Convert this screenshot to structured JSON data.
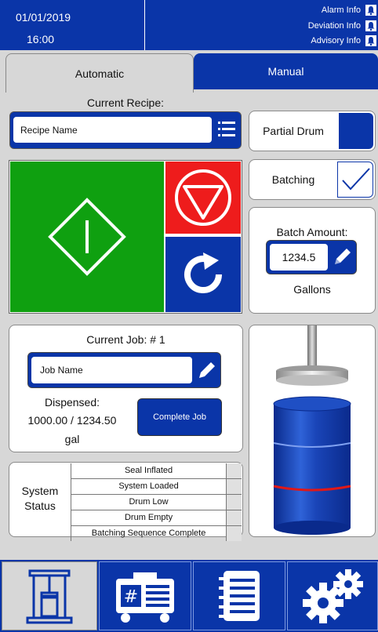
{
  "header": {
    "date": "01/01/2019",
    "time": "16:00",
    "alarm_info": "Alarm Info",
    "deviation_info": "Deviation Info",
    "advisory_info": "Advisory Info"
  },
  "tabs": {
    "automatic": "Automatic",
    "manual": "Manual"
  },
  "recipe": {
    "label": "Current Recipe:",
    "value": "Recipe Name"
  },
  "partial_drum": {
    "label": "Partial Drum"
  },
  "batching": {
    "label": "Batching",
    "checked": true
  },
  "batch_amount": {
    "label": "Batch Amount:",
    "value": "1234.5",
    "unit": "Gallons"
  },
  "current_job": {
    "label": "Current Job: # 1",
    "job_name": "Job Name",
    "dispensed_label": "Dispensed:",
    "dispensed_value": "1000.00 / 1234.50",
    "dispensed_unit": "gal",
    "complete_button": "Complete Job"
  },
  "system_status": {
    "label_line1": "System",
    "label_line2": "Status",
    "items": [
      "Seal Inflated",
      "System Loaded",
      "Drum Low",
      "Drum Empty",
      "Batching Sequence Complete"
    ]
  },
  "colors": {
    "brand_blue": "#0a35a8",
    "start_green": "#0fa010",
    "stop_red": "#ee1c1c",
    "panel_gray": "#d7d7d7",
    "drum_band_red": "#e01818"
  },
  "nav": {
    "items": [
      "press-machine-icon",
      "drum-calculator-icon",
      "notebook-list-icon",
      "gears-icon"
    ]
  }
}
